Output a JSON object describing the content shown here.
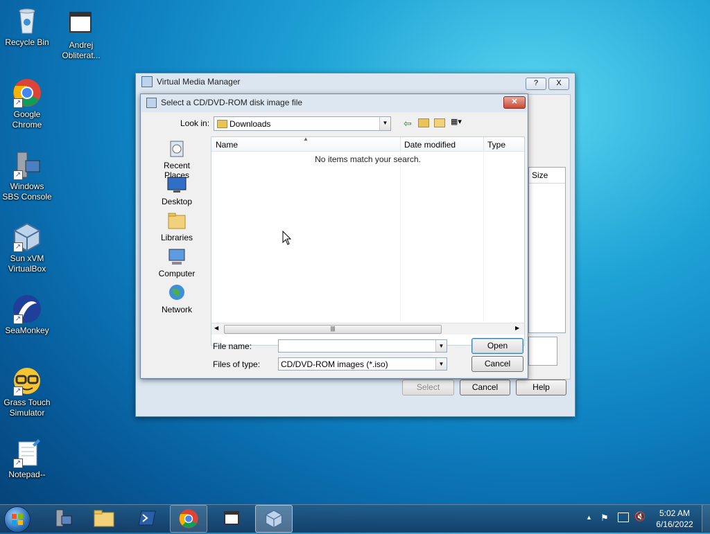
{
  "desktop": {
    "icons": [
      {
        "label": "Recycle Bin"
      },
      {
        "label": "Andrej Obliterat..."
      },
      {
        "label": "Google Chrome"
      },
      {
        "label": "Windows SBS Console"
      },
      {
        "label": "Sun xVM VirtualBox"
      },
      {
        "label": "SeaMonkey"
      },
      {
        "label": "Grass Touch Simulator"
      },
      {
        "label": "Notepad--"
      }
    ]
  },
  "vmm": {
    "title": "Virtual Media Manager",
    "help_glyph": "?",
    "close_glyph": "X",
    "col_size": "Size",
    "select_label": "Select",
    "cancel_label": "Cancel",
    "help_label": "Help"
  },
  "dialog": {
    "title": "Select a CD/DVD-ROM disk image file",
    "look_in_label": "Look in:",
    "look_in_value": "Downloads",
    "columns": [
      "Name",
      "Date modified",
      "Type"
    ],
    "empty_message": "No items match your search.",
    "places": [
      "Recent Places",
      "Desktop",
      "Libraries",
      "Computer",
      "Network"
    ],
    "file_name_label": "File name:",
    "file_name_value": "",
    "files_of_type_label": "Files of type:",
    "files_of_type_value": "CD/DVD-ROM images (*.iso)",
    "open_label": "Open",
    "cancel_label": "Cancel"
  },
  "taskbar": {
    "time": "5:02 AM",
    "date": "6/16/2022"
  },
  "colors": {
    "accent": "#1a5fb4",
    "taskbar": "#1c4a73"
  }
}
